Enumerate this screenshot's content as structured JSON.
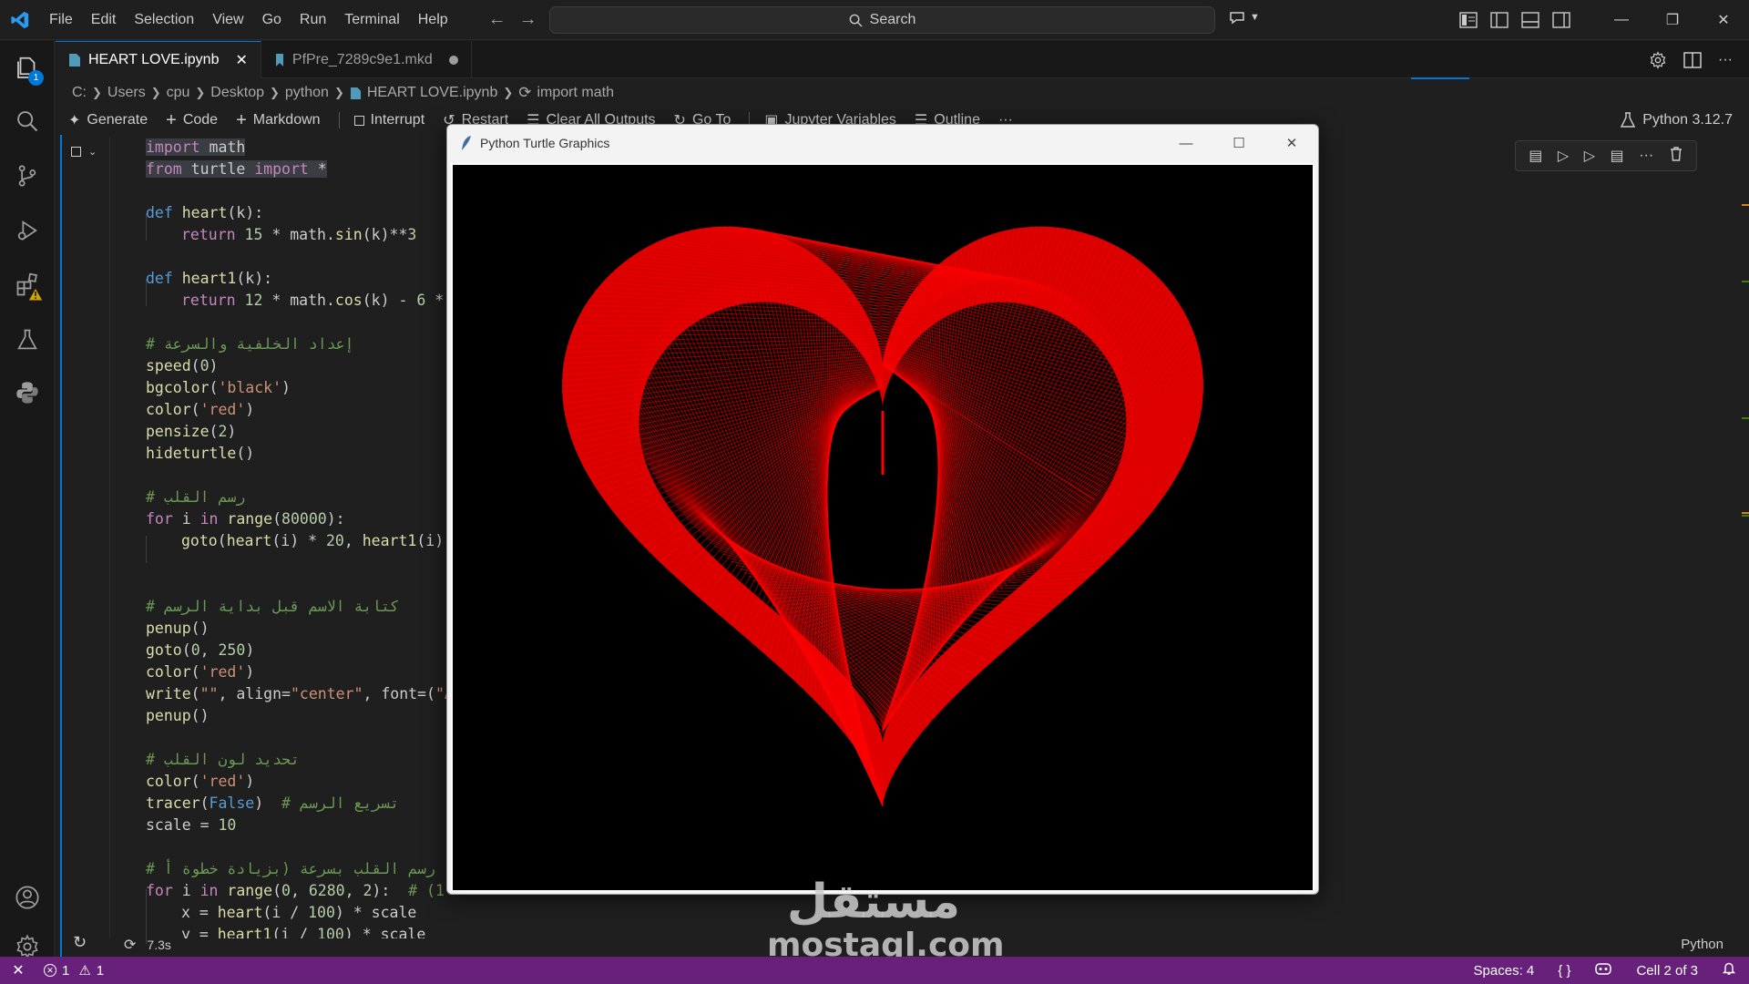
{
  "menu": [
    "File",
    "Edit",
    "Selection",
    "View",
    "Go",
    "Run",
    "Terminal",
    "Help"
  ],
  "search": {
    "label": "Search"
  },
  "activity": {
    "explorer_badge": "1"
  },
  "tabs": [
    {
      "label": "HEART LOVE.ipynb",
      "active": true
    },
    {
      "label": "PfPre_7289c9e1.mkd",
      "active": false
    }
  ],
  "breadcrumb": [
    "C:",
    "Users",
    "cpu",
    "Desktop",
    "python",
    "HEART LOVE.ipynb",
    "import math"
  ],
  "toolbar": {
    "generate": "Generate",
    "code": "Code",
    "markdown": "Markdown",
    "interrupt": "Interrupt",
    "restart": "Restart",
    "clear": "Clear All Outputs",
    "goto": "Go To",
    "variables": "Jupyter Variables",
    "outline": "Outline",
    "more": "···",
    "kernel": "Python 3.12.7"
  },
  "code": {
    "l1a": "import",
    "l1b": " math",
    "l2a": "from",
    "l2b": " turtle ",
    "l2c": "import",
    "l2d": " *",
    "l4a": "def",
    "l4b": " heart",
    "l4c": "(k):",
    "l5a": "return",
    "l5b": " 15",
    "l5c": " * math.",
    "l5d": "sin",
    "l5e": "(k)**",
    "l5f": "3",
    "l7a": "def",
    "l7b": " heart1",
    "l7c": "(k):",
    "l8a": "return",
    "l8b": " 12",
    "l8c": " * math.",
    "l8d": "cos",
    "l8e": "(k) - ",
    "l8f": "6",
    "l8g": " * m",
    "l10": "# إعداد الخلفية والسرعة",
    "l11a": "speed",
    "l11b": "(",
    "l11c": "0",
    "l11d": ")",
    "l12a": "bgcolor",
    "l12b": "(",
    "l12c": "'black'",
    "l12d": ")",
    "l13a": "color",
    "l13b": "(",
    "l13c": "'red'",
    "l13d": ")",
    "l14a": "pensize",
    "l14b": "(",
    "l14c": "2",
    "l14d": ")",
    "l15a": "hideturtle",
    "l15b": "()",
    "l17": "# رسم القلب",
    "l18a": "for",
    "l18b": " i ",
    "l18c": "in",
    "l18d": " range",
    "l18e": "(",
    "l18f": "80000",
    "l18g": "):",
    "l19a": "goto",
    "l19b": "(",
    "l19c": "heart",
    "l19d": "(i) * ",
    "l19e": "20",
    "l19f": ", ",
    "l19g": "heart1",
    "l19h": "(i) *",
    "l22": "# كتابة الاسم قبل بداية الرسم",
    "l23a": "penup",
    "l23b": "()",
    "l24a": "goto",
    "l24b": "(",
    "l24c": "0",
    "l24d": ", ",
    "l24e": "250",
    "l24f": ")",
    "l25a": "color",
    "l25b": "(",
    "l25c": "'red'",
    "l25d": ")",
    "l26a": "write",
    "l26b": "(",
    "l26c": "\"\"",
    "l26d": ", align=",
    "l26e": "\"center\"",
    "l26f": ", font=(",
    "l26g": "\"Ar",
    "l27a": "penup",
    "l27b": "()",
    "l29": "# تحديد لون القلب",
    "l30a": "color",
    "l30b": "(",
    "l30c": "'red'",
    "l30d": ")",
    "l31a": "tracer",
    "l31b": "(",
    "l31c": "False",
    "l31d": ")  ",
    "l31e": "# تسريع الرسم",
    "l32a": "scale",
    "l32b": " = ",
    "l32c": "10",
    "l34": "# رسم القلب بسرعة (بزيادة خطوة أ",
    "l35a": "for",
    "l35b": " i ",
    "l35c": "in",
    "l35d": " range",
    "l35e": "(",
    "l35f": "0",
    "l35g": ", ",
    "l35h": "6280",
    "l35i": ", ",
    "l35j": "2",
    "l35k": "):  ",
    "l35l": "# (1",
    "l36a": "x",
    "l36b": " = ",
    "l36c": "heart",
    "l36d": "(i / ",
    "l36e": "100",
    "l36f": ") * scale",
    "l37a": "y",
    "l37b": " = ",
    "l37c": "heart1",
    "l37d": "(i / ",
    "l37e": "100",
    "l37f": ") * scale"
  },
  "cell": {
    "exec_time": "7.3s",
    "language": "Python"
  },
  "turtle": {
    "title": "Python Turtle Graphics",
    "heart_color": "#ff0000",
    "bg_color": "#000000"
  },
  "status": {
    "errors": "1",
    "warnings": "1",
    "spaces": "Spaces: 4",
    "braces": "{ }",
    "cell": "Cell 2 of 3"
  },
  "watermark": {
    "arabic": "مستقل",
    "latin": "mostaql.com"
  },
  "colors": {
    "accent": "#0078d4",
    "statusbar": "#68217a"
  }
}
